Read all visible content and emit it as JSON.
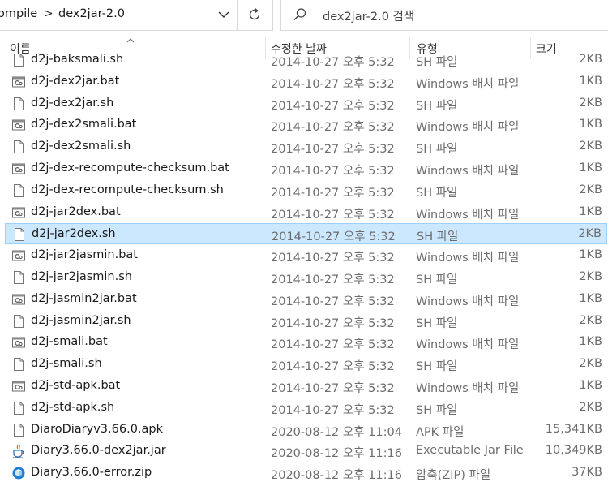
{
  "address_bar": {
    "crumbs": [
      "ompile",
      "dex2jar-2.0"
    ],
    "separator": ">"
  },
  "search": {
    "placeholder": "dex2jar-2.0 검색"
  },
  "columns": {
    "name": "이름",
    "date": "수정한 날짜",
    "type": "유형",
    "size": "크기"
  },
  "files": [
    {
      "name": "d2j-baksmali.sh",
      "date": "2014-10-27 오후 5:32",
      "type": "SH 파일",
      "size": "2KB",
      "icon": "script-file-icon"
    },
    {
      "name": "d2j-dex2jar.bat",
      "date": "2014-10-27 오후 5:32",
      "type": "Windows 배치 파일",
      "size": "1KB",
      "icon": "batch-file-icon"
    },
    {
      "name": "d2j-dex2jar.sh",
      "date": "2014-10-27 오후 5:32",
      "type": "SH 파일",
      "size": "2KB",
      "icon": "script-file-icon"
    },
    {
      "name": "d2j-dex2smali.bat",
      "date": "2014-10-27 오후 5:32",
      "type": "Windows 배치 파일",
      "size": "1KB",
      "icon": "batch-file-icon"
    },
    {
      "name": "d2j-dex2smali.sh",
      "date": "2014-10-27 오후 5:32",
      "type": "SH 파일",
      "size": "2KB",
      "icon": "script-file-icon"
    },
    {
      "name": "d2j-dex-recompute-checksum.bat",
      "date": "2014-10-27 오후 5:32",
      "type": "Windows 배치 파일",
      "size": "1KB",
      "icon": "batch-file-icon"
    },
    {
      "name": "d2j-dex-recompute-checksum.sh",
      "date": "2014-10-27 오후 5:32",
      "type": "SH 파일",
      "size": "2KB",
      "icon": "script-file-icon"
    },
    {
      "name": "d2j-jar2dex.bat",
      "date": "2014-10-27 오후 5:32",
      "type": "Windows 배치 파일",
      "size": "1KB",
      "icon": "batch-file-icon"
    },
    {
      "name": "d2j-jar2dex.sh",
      "date": "2014-10-27 오후 5:32",
      "type": "SH 파일",
      "size": "2KB",
      "icon": "script-file-icon",
      "selected": true
    },
    {
      "name": "d2j-jar2jasmin.bat",
      "date": "2014-10-27 오후 5:32",
      "type": "Windows 배치 파일",
      "size": "1KB",
      "icon": "batch-file-icon"
    },
    {
      "name": "d2j-jar2jasmin.sh",
      "date": "2014-10-27 오후 5:32",
      "type": "SH 파일",
      "size": "2KB",
      "icon": "script-file-icon"
    },
    {
      "name": "d2j-jasmin2jar.bat",
      "date": "2014-10-27 오후 5:32",
      "type": "Windows 배치 파일",
      "size": "1KB",
      "icon": "batch-file-icon"
    },
    {
      "name": "d2j-jasmin2jar.sh",
      "date": "2014-10-27 오후 5:32",
      "type": "SH 파일",
      "size": "2KB",
      "icon": "script-file-icon"
    },
    {
      "name": "d2j-smali.bat",
      "date": "2014-10-27 오후 5:32",
      "type": "Windows 배치 파일",
      "size": "1KB",
      "icon": "batch-file-icon"
    },
    {
      "name": "d2j-smali.sh",
      "date": "2014-10-27 오후 5:32",
      "type": "SH 파일",
      "size": "2KB",
      "icon": "script-file-icon"
    },
    {
      "name": "d2j-std-apk.bat",
      "date": "2014-10-27 오후 5:32",
      "type": "Windows 배치 파일",
      "size": "1KB",
      "icon": "batch-file-icon"
    },
    {
      "name": "d2j-std-apk.sh",
      "date": "2014-10-27 오후 5:32",
      "type": "SH 파일",
      "size": "2KB",
      "icon": "script-file-icon"
    },
    {
      "name": "DiaroDiaryv3.66.0.apk",
      "date": "2020-08-12 오후 11:04",
      "type": "APK 파일",
      "size": "15,341KB",
      "icon": "blank-file-icon"
    },
    {
      "name": "Diary3.66.0-dex2jar.jar",
      "date": "2020-08-12 오후 11:16",
      "type": "Executable Jar File",
      "size": "10,349KB",
      "icon": "java-jar-icon"
    },
    {
      "name": "Diary3.66.0-error.zip",
      "date": "2020-08-12 오후 11:16",
      "type": "압축(ZIP) 파일",
      "size": "37KB",
      "icon": "zip-file-icon"
    }
  ],
  "colors": {
    "selection_bg": "#cce8ff",
    "selection_border": "#99d1ff"
  }
}
